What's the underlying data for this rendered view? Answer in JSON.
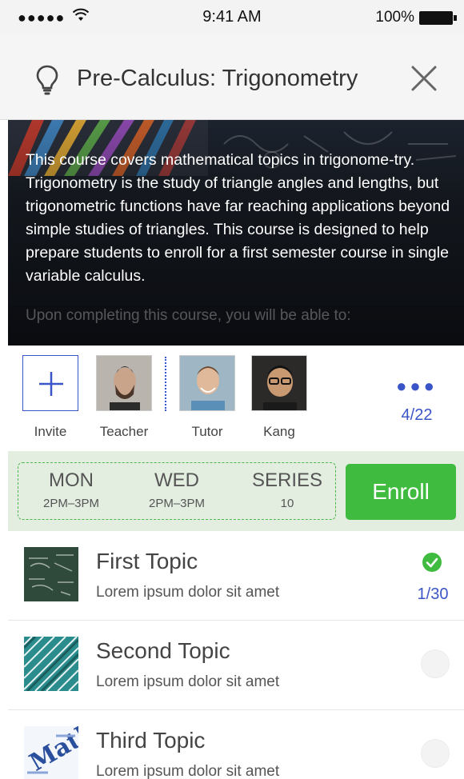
{
  "status_bar": {
    "signal": "●●●●●",
    "time": "9:41 AM",
    "battery": "100%"
  },
  "header": {
    "icon": "lightbulb-icon",
    "title": "Pre-Calculus: Trigonometry",
    "close_icon": "close-icon"
  },
  "hero": {
    "description": "This course covers mathematical topics in trigonome-try. Trigonometry is the study of triangle angles and lengths, but trigonometric functions have far reaching applications beyond simple studies of triangles. This course is designed to help prepare students to enroll for a first semester course in single variable calculus.",
    "description_faded": "Upon completing this course, you will be able to:"
  },
  "people": {
    "invite_label": "Invite",
    "members": [
      {
        "label": "Teacher"
      },
      {
        "label": "Tutor"
      },
      {
        "label": "Kang"
      }
    ],
    "count": "4/22"
  },
  "schedule": {
    "slots": [
      {
        "day": "MON",
        "time": "2PM–3PM"
      },
      {
        "day": "WED",
        "time": "2PM–3PM"
      },
      {
        "day": "SERIES",
        "time": "10"
      }
    ],
    "enroll_label": "Enroll",
    "colors": {
      "accent": "#3fbc3f",
      "background": "#e3eee1"
    }
  },
  "topics": [
    {
      "name": "First Topic",
      "subtitle": "Lorem ipsum dolor sit amet",
      "completed": true,
      "progress": "1/30"
    },
    {
      "name": "Second Topic",
      "subtitle": "Lorem ipsum dolor sit amet",
      "completed": false
    },
    {
      "name": "Third Topic",
      "subtitle": "Lorem ipsum dolor sit amet",
      "completed": false
    }
  ],
  "colors": {
    "link": "#3a55c7"
  }
}
